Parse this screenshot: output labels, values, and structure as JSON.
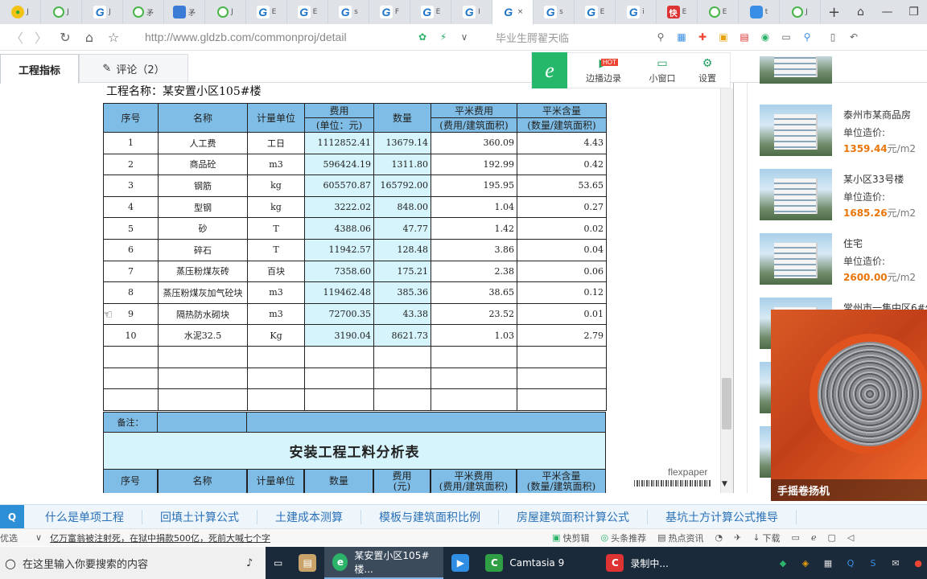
{
  "browser": {
    "tabs": [
      {
        "icon": "y",
        "label": "J"
      },
      {
        "icon": "q",
        "label": "J"
      },
      {
        "icon": "g",
        "label": "J"
      },
      {
        "icon": "q",
        "label": "矛"
      },
      {
        "icon": "b",
        "label": "矛"
      },
      {
        "icon": "q",
        "label": "J"
      },
      {
        "icon": "g",
        "label": "E"
      },
      {
        "icon": "g",
        "label": "E"
      },
      {
        "icon": "g",
        "label": "s"
      },
      {
        "icon": "g",
        "label": "F"
      },
      {
        "icon": "g",
        "label": "E"
      },
      {
        "icon": "g",
        "label": "I"
      },
      {
        "icon": "g",
        "label": "×",
        "active": true
      },
      {
        "icon": "g",
        "label": "s"
      },
      {
        "icon": "g",
        "label": "E"
      },
      {
        "icon": "g",
        "label": "i"
      },
      {
        "icon": "r",
        "label": "E"
      },
      {
        "icon": "q",
        "label": "E"
      },
      {
        "icon": "s",
        "label": "t"
      },
      {
        "icon": "q",
        "label": "J"
      }
    ],
    "new_tab": "+",
    "url": "http://www.gldzb.com/commonproj/detail",
    "url_hint": "毕业生腭翟天临"
  },
  "page_tabs": {
    "indicator": "工程指标",
    "comments": "评论（2）"
  },
  "toolbar": {
    "logo": "e",
    "broadcast": "边播边录",
    "hot": "HOT",
    "mini": "小窗口",
    "settings": "设置"
  },
  "document": {
    "title": "工程名称：某安置小区105#楼",
    "headers": [
      "序号",
      "名称",
      "计量单位",
      "费用",
      "(单位：元)",
      "数量",
      "平米费用",
      "(费用/建筑面积)",
      "平米含量",
      "(数量/建筑面积)"
    ],
    "rows": [
      [
        "1",
        "人工费",
        "工日",
        "1112852.41",
        "13679.14",
        "360.09",
        "4.43"
      ],
      [
        "2",
        "商品砼",
        "m3",
        "596424.19",
        "1311.80",
        "192.99",
        "0.42"
      ],
      [
        "3",
        "钢筋",
        "kg",
        "605570.87",
        "165792.00",
        "195.95",
        "53.65"
      ],
      [
        "4",
        "型钢",
        "kg",
        "3222.02",
        "848.00",
        "1.04",
        "0.27"
      ],
      [
        "5",
        "砂",
        "T",
        "4388.06",
        "47.77",
        "1.42",
        "0.02"
      ],
      [
        "6",
        "碎石",
        "T",
        "11942.57",
        "128.48",
        "3.86",
        "0.04"
      ],
      [
        "7",
        "蒸压粉煤灰砖",
        "百块",
        "7358.60",
        "175.21",
        "2.38",
        "0.06"
      ],
      [
        "8",
        "蒸压粉煤灰加气砼块",
        "m3",
        "119462.48",
        "385.36",
        "38.65",
        "0.12"
      ],
      [
        "9",
        "隔热防水砌块",
        "m3",
        "72700.35",
        "43.38",
        "23.52",
        "0.01"
      ],
      [
        "10",
        "水泥32.5",
        "Kg",
        "3190.04",
        "8621.73",
        "1.03",
        "2.79"
      ]
    ],
    "note_label": "备注：",
    "section2_title": "安装工程工料分析表",
    "section2_headers": [
      "序号",
      "名称",
      "计量单位",
      "数量",
      "费用\n(元)",
      "平米费用\n(费用/建筑面积)",
      "平米含量\n(数量/建筑面积)"
    ],
    "viewer_brand": "flexpaper"
  },
  "sidebar": {
    "price_label": "单位造价:",
    "unit": "元/m2",
    "items": [
      {
        "name": "泰州市某商品房",
        "price": "1359.44"
      },
      {
        "name": "某小区33号楼",
        "price": "1685.26"
      },
      {
        "name": "住宅",
        "price": "2600.00"
      },
      {
        "name": "常州市一集中区6#住",
        "price": ""
      }
    ]
  },
  "video": {
    "caption": "手摇卷扬机"
  },
  "keywords": [
    "什么是单项工程",
    "回填土计算公式",
    "土建成本测算",
    "模板与建筑面积比例",
    "房屋建筑面积计算公式",
    "基坑土方计算公式推导"
  ],
  "statusbar": {
    "left": "优选",
    "news": "亿万富翁被注射死，在狱中捐款500亿，死前大喊七个字",
    "items": [
      "快剪辑",
      "头条推荐",
      "热点资讯",
      "下载"
    ]
  },
  "taskbar": {
    "search_placeholder": "在这里输入你要搜索的内容",
    "apps": [
      "某安置小区105#楼...",
      "Camtasia 9",
      "录制中..."
    ]
  }
}
